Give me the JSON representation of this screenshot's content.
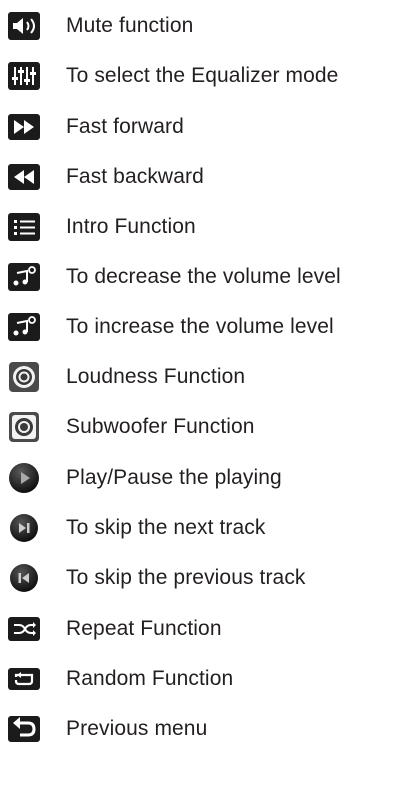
{
  "legend": {
    "items": [
      {
        "icon": "mute-icon",
        "label": "Mute function"
      },
      {
        "icon": "equalizer-icon",
        "label": "To select the Equalizer mode"
      },
      {
        "icon": "fast-forward-icon",
        "label": "Fast forward"
      },
      {
        "icon": "fast-backward-icon",
        "label": "Fast backward"
      },
      {
        "icon": "intro-list-icon",
        "label": "Intro Function"
      },
      {
        "icon": "volume-down-icon",
        "label": "To decrease the volume level"
      },
      {
        "icon": "volume-up-icon",
        "label": "To increase the volume level"
      },
      {
        "icon": "loudness-icon",
        "label": "Loudness Function"
      },
      {
        "icon": "subwoofer-icon",
        "label": "Subwoofer Function"
      },
      {
        "icon": "play-pause-icon",
        "label": "Play/Pause the playing"
      },
      {
        "icon": "skip-next-icon",
        "label": "To skip the next track"
      },
      {
        "icon": "skip-previous-icon",
        "label": "To skip the previous track"
      },
      {
        "icon": "repeat-icon",
        "label": "Repeat Function"
      },
      {
        "icon": "random-icon",
        "label": "Random Function"
      },
      {
        "icon": "previous-menu-icon",
        "label": "Previous menu"
      }
    ]
  }
}
